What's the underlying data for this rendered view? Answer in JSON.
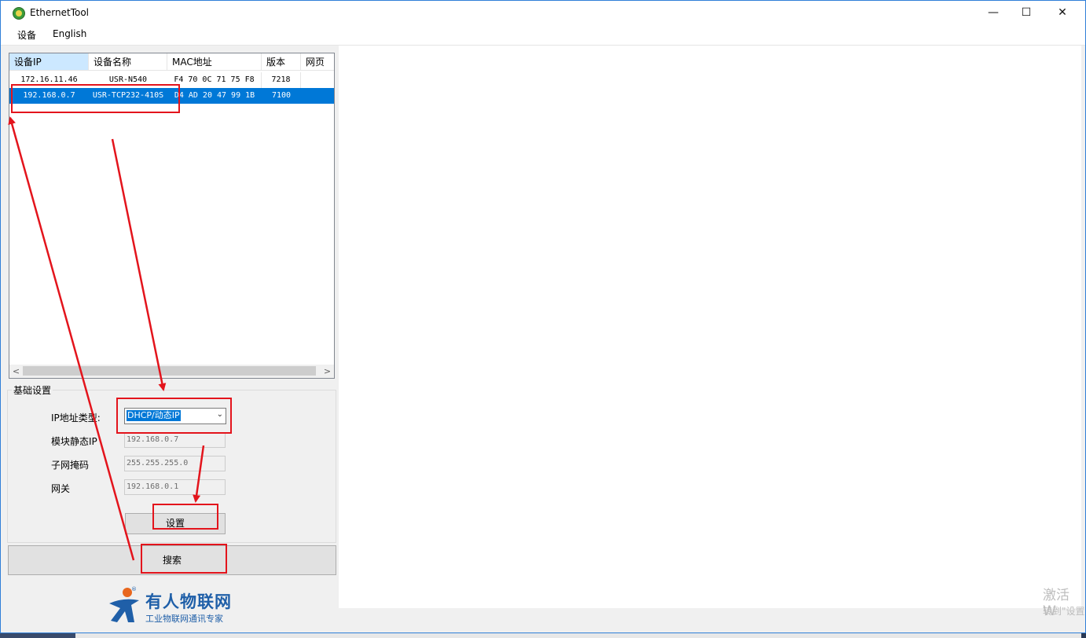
{
  "window": {
    "title": "EthernetTool",
    "minimize": "—",
    "maximize": "☐",
    "close": "✕"
  },
  "menu": [
    "设备",
    "English"
  ],
  "device_list": {
    "columns": [
      "设备IP",
      "设备名称",
      "MAC地址",
      "版本",
      "网页"
    ],
    "rows": [
      [
        "172.16.11.46",
        "USR-N540",
        "F4 70 0C 71 75 F8",
        "7218",
        ""
      ],
      [
        "192.168.0.7",
        "USR-TCP232-410S",
        "D4 AD 20 47 99 1B",
        "7100",
        ""
      ]
    ],
    "selected_row": 1,
    "scroll_left": "<",
    "scroll_right": ">"
  },
  "basic_settings": {
    "title": "基础设置",
    "ip_type_label": "IP地址类型:",
    "ip_type_value": "DHCP/动态IP",
    "static_ip_label": "模块静态IP",
    "static_ip_value": "192.168.0.7",
    "subnet_label": "子网掩码",
    "subnet_value": "255.255.255.0",
    "gateway_label": "网关",
    "gateway_value": "192.168.0.1",
    "set_button": "设置"
  },
  "search_button": "搜索",
  "logo": {
    "name": "有人物联网",
    "slogan": "工业物联网通讯专家",
    "reg": "®"
  },
  "watermark": {
    "line1": "激活 W",
    "line2": "转到\"设置"
  },
  "colors": {
    "selection": "#0078d7",
    "annotation": "#e3141c",
    "logo": "#1f5fa8"
  }
}
